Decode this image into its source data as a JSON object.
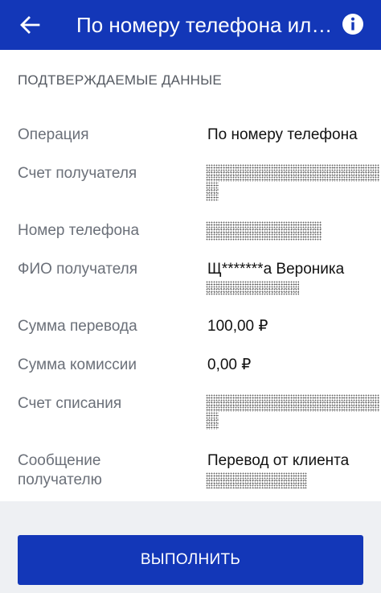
{
  "header": {
    "title": "По номеру телефона ил…",
    "back_icon": "arrow-left-icon",
    "info_icon": "info-icon"
  },
  "section_title": "ПОДТВЕРЖДАЕМЫЕ ДАННЫЕ",
  "rows": [
    {
      "label": "Операция",
      "value": "По номеру телефона"
    },
    {
      "label": "Счет получателя",
      "value": ""
    },
    {
      "label": "Номер телефона",
      "value": ""
    },
    {
      "label": "ФИО получателя",
      "value": "Щ*******а Вероника"
    },
    {
      "label": "Сумма перевода",
      "value": "100,00 ₽"
    },
    {
      "label": "Сумма комиссии",
      "value": "0,00 ₽"
    },
    {
      "label": "Счет списания",
      "value": ""
    },
    {
      "label": "Сообщение получателю",
      "value": "Перевод от клиента"
    }
  ],
  "action": {
    "label": "ВЫПОЛНИТЬ"
  },
  "colors": {
    "primary": "#1337b8",
    "background": "#eef0f3"
  }
}
